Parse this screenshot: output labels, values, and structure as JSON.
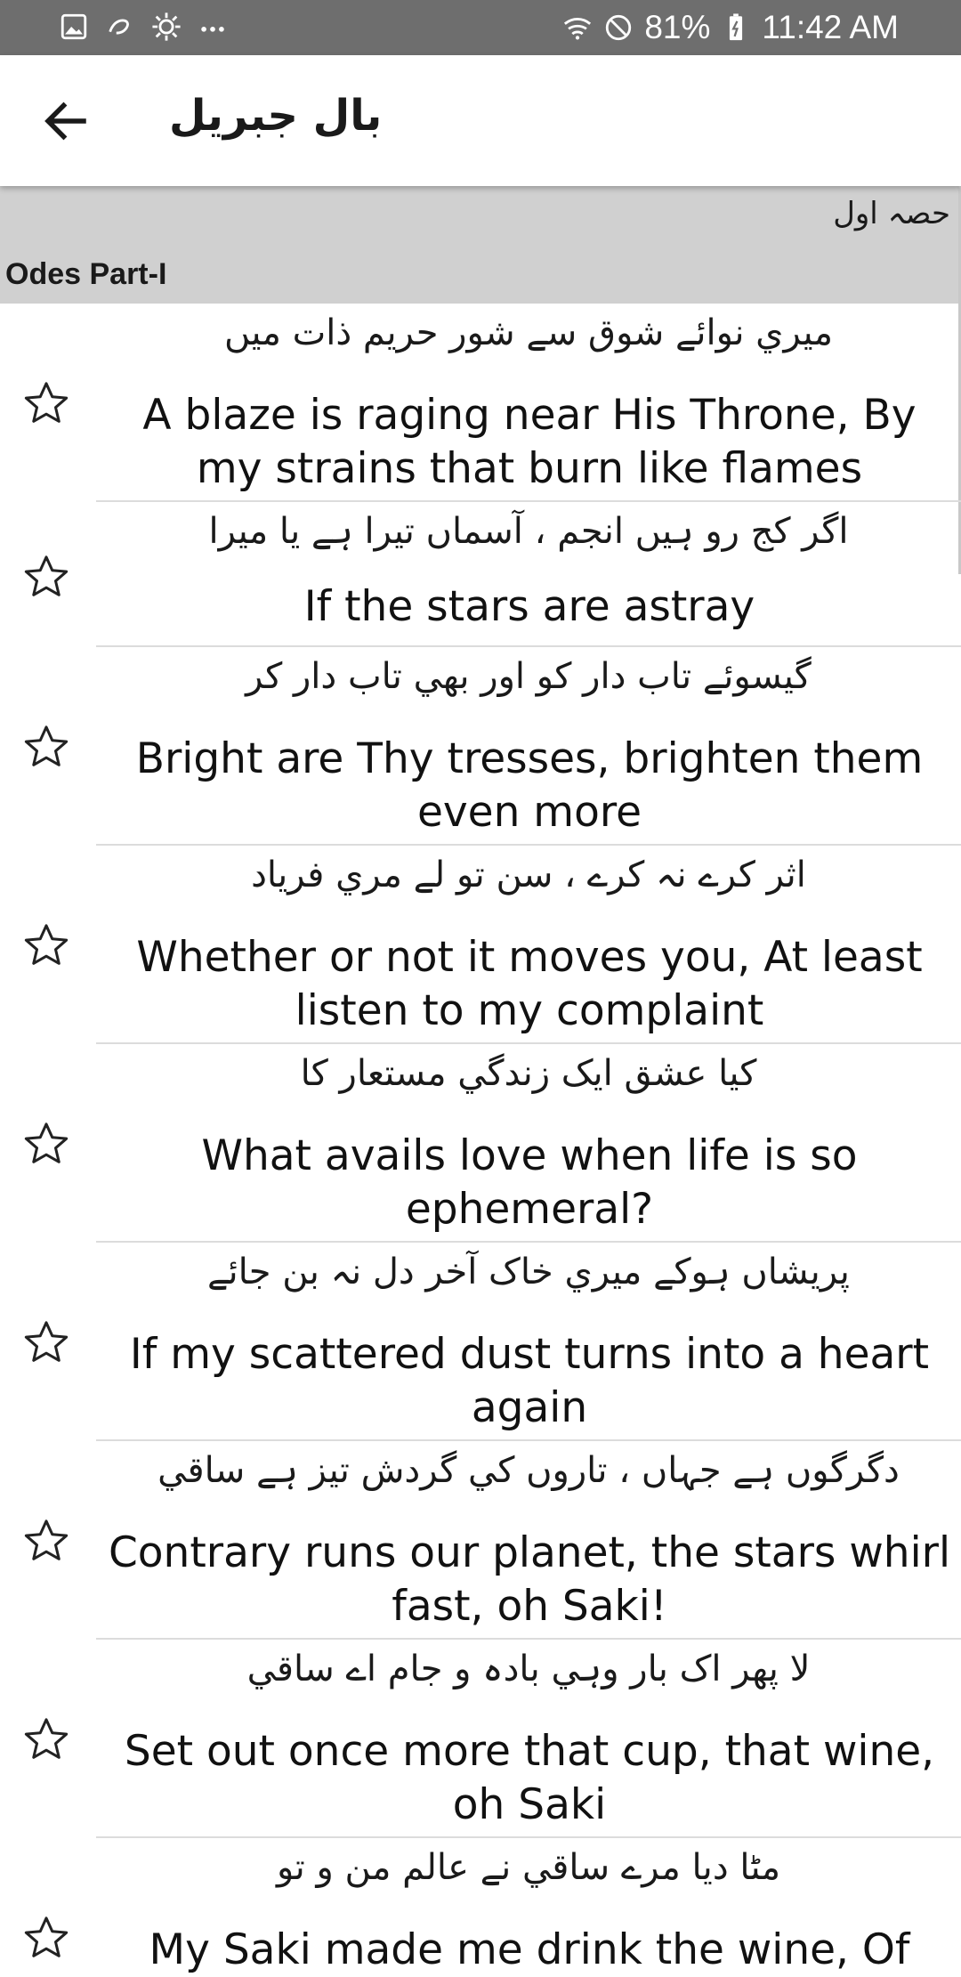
{
  "status_bar": {
    "notification_icons": [
      "gallery-icon",
      "link-icon",
      "sun-icon",
      "more-dots-icon"
    ],
    "battery": "81%",
    "time": "11:42 AM"
  },
  "app_bar": {
    "title": "بال جبريل"
  },
  "section": {
    "urdu_title": "حصہ اول",
    "english_title": "Odes Part-I"
  },
  "odes": [
    {
      "urdu": "ميري نوائے شوق سے شور حريم ذات ميں",
      "english": "A blaze is raging near His Throne, By my strains that burn like flames"
    },
    {
      "urdu": "اگر کج رو ہيں انجم ، آسماں تيرا ہے يا ميرا",
      "english": "If the stars are astray"
    },
    {
      "urdu": "گيسوئے تاب دار کو اور بھي تاب دار کر",
      "english": "Bright are Thy tresses, brighten them even more"
    },
    {
      "urdu": "اثر کرے نہ کرے ، سن تو لے مري فرياد",
      "english": "Whether or not it moves you, At least listen to my complaint"
    },
    {
      "urdu": "کيا عشق ايک زندگي مستعار کا",
      "english": "What avails love when life is so ephemeral?"
    },
    {
      "urdu": "پريشاں ہوکے ميري خاک آخر دل نہ بن جائے",
      "english": "If my scattered dust turns into a heart again"
    },
    {
      "urdu": "دگرگوں ہے جہاں ، تاروں کي گردش تيز ہے ساقي",
      "english": "Contrary runs our planet, the stars whirl fast, oh Saki!"
    },
    {
      "urdu": "لا پھر اک بار وہي بادہ و جام اے ساقي",
      "english": "Set out once more that cup, that wine, oh Saki"
    },
    {
      "urdu": "مٹا ديا مرے ساقي نے عالم من و تو",
      "english": "My Saki made me drink the wine, Of"
    }
  ],
  "colors": {
    "status_bar": "#6e6e6e",
    "section_header": "#d0d0d0",
    "divider": "#dcdcdc"
  }
}
